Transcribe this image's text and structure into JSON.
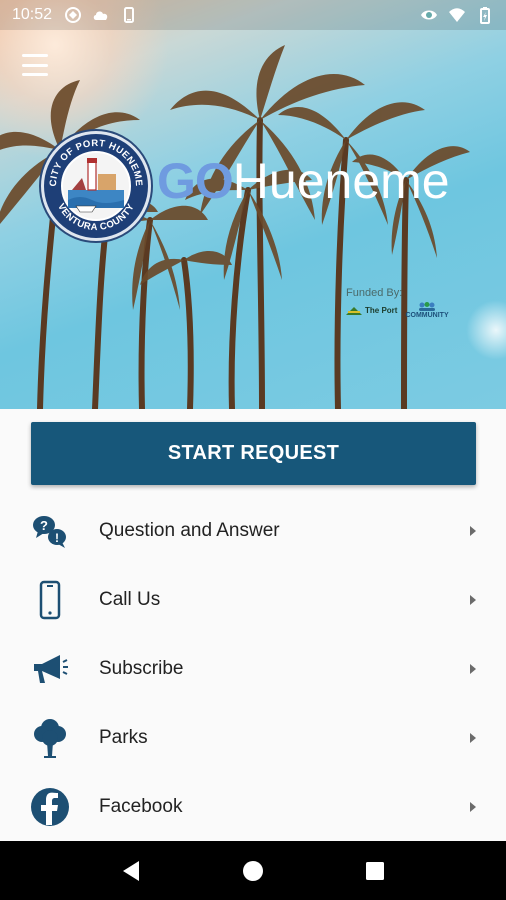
{
  "status_bar": {
    "time": "10:52",
    "icons_left": [
      "data-saver-icon",
      "cloud-icon",
      "phone-icon"
    ],
    "icons_right": [
      "eye-icon",
      "wifi-icon",
      "battery-icon"
    ]
  },
  "header": {
    "logo_go": "GO",
    "logo_rest": "Hueneme",
    "seal_top_text": "CITY OF PORT HUENEME",
    "seal_bottom_text": "VENTURA COUNTY",
    "funded_by": "Funded By:",
    "sponsor_port": "The Port",
    "sponsor_community": "COMMUNITY"
  },
  "start_button": "START REQUEST",
  "menu": [
    {
      "name": "question-and-answer",
      "label": "Question and Answer",
      "icon": "question-bubbles-icon"
    },
    {
      "name": "call-us",
      "label": "Call Us",
      "icon": "smartphone-icon"
    },
    {
      "name": "subscribe",
      "label": "Subscribe",
      "icon": "megaphone-icon"
    },
    {
      "name": "parks",
      "label": "Parks",
      "icon": "tree-icon"
    },
    {
      "name": "facebook",
      "label": "Facebook",
      "icon": "facebook-icon"
    }
  ],
  "colors": {
    "primary": "#17577a",
    "icon": "#1d4f73",
    "text": "#222222",
    "chevron": "#6b6b6b"
  }
}
